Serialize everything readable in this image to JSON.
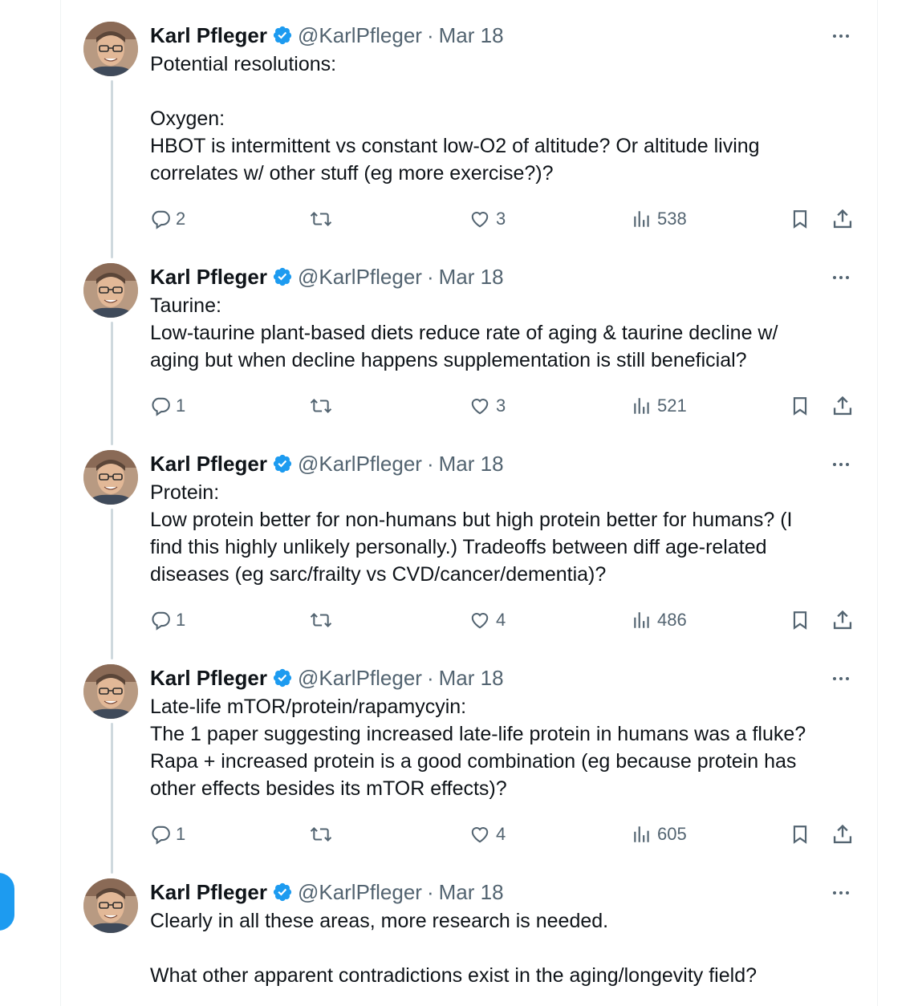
{
  "author": {
    "name": "Karl Pfleger",
    "handle": "@KarlPfleger",
    "separator": "·"
  },
  "colors": {
    "text": "#0f1419",
    "secondary": "#536471",
    "verified": "#1d9bf0",
    "thread_line": "#cfd9de",
    "accent": "#1d9bf0"
  },
  "icons": {
    "reply": "reply-icon",
    "retweet": "retweet-icon",
    "like": "heart-icon",
    "views": "views-icon",
    "bookmark": "bookmark-icon",
    "share": "share-icon",
    "more": "more-icon",
    "verified": "verified-badge-icon"
  },
  "tweets": [
    {
      "date": "Mar 18",
      "lines": [
        "Potential resolutions:",
        "",
        "Oxygen:",
        "HBOT is intermittent vs constant low-O2 of altitude? Or altitude living",
        "correlates w/ other stuff (eg more exercise?)?"
      ],
      "replies": "2",
      "likes": "3",
      "views": "538"
    },
    {
      "date": "Mar 18",
      "lines": [
        "Taurine:",
        "Low-taurine plant-based diets reduce rate of aging & taurine decline w/",
        "aging but when decline happens supplementation is still beneficial?"
      ],
      "replies": "1",
      "likes": "3",
      "views": "521"
    },
    {
      "date": "Mar 18",
      "lines": [
        "Protein:",
        "Low protein better for non-humans but high protein better for humans? (I",
        "find this highly unlikely personally.) Tradeoffs between diff age-related",
        "diseases (eg sarc/frailty vs CVD/cancer/dementia)?"
      ],
      "replies": "1",
      "likes": "4",
      "views": "486"
    },
    {
      "date": "Mar 18",
      "lines": [
        "Late-life mTOR/protein/rapamycyin:",
        "The 1 paper suggesting increased late-life protein in humans was a fluke?",
        "Rapa + increased protein is a good combination (eg because protein has",
        "other effects besides its mTOR effects)?"
      ],
      "replies": "1",
      "likes": "4",
      "views": "605"
    },
    {
      "date": "Mar 18",
      "lines": [
        "Clearly in all these areas, more research is needed.",
        "",
        "What other apparent contradictions exist in the aging/longevity field?"
      ]
    }
  ]
}
